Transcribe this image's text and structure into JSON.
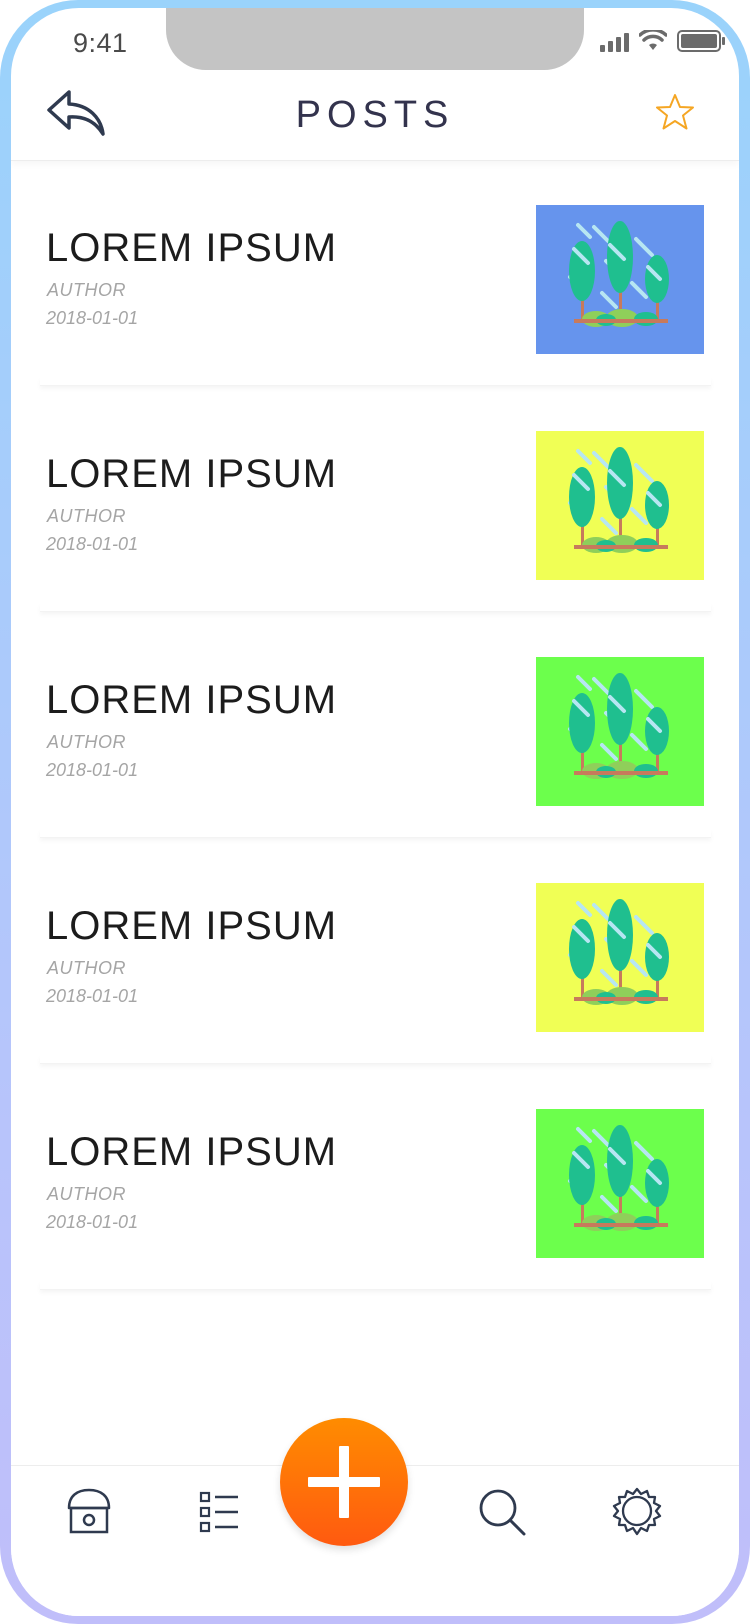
{
  "status_bar": {
    "time": "9:41"
  },
  "header": {
    "title": "POSTS"
  },
  "colors": {
    "accent": "#ff6a00",
    "star": "#f5a623",
    "icon": "#2f3a4f"
  },
  "posts": [
    {
      "title": "LOREM IPSUM",
      "author": "AUTHOR",
      "date": "2018-01-01",
      "thumb_bg": "#6694ed"
    },
    {
      "title": "LOREM IPSUM",
      "author": "AUTHOR",
      "date": "2018-01-01",
      "thumb_bg": "#f0ff55"
    },
    {
      "title": "LOREM IPSUM",
      "author": "AUTHOR",
      "date": "2018-01-01",
      "thumb_bg": "#6cff4c"
    },
    {
      "title": "LOREM IPSUM",
      "author": "AUTHOR",
      "date": "2018-01-01",
      "thumb_bg": "#f0ff55"
    },
    {
      "title": "LOREM IPSUM",
      "author": "AUTHOR",
      "date": "2018-01-01",
      "thumb_bg": "#6cff4c"
    }
  ],
  "tabbar": {
    "items": [
      "home-icon",
      "list-icon",
      "add-icon",
      "search-icon",
      "settings-icon"
    ]
  }
}
